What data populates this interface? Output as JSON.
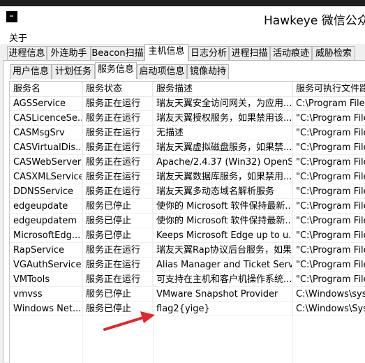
{
  "window": {
    "title": "Hawkeye 微信公众号"
  },
  "menubar": {
    "items": [
      "关于"
    ]
  },
  "main_tabs": [
    "进程信息",
    "外连助手",
    "Beacon扫描",
    "主机信息",
    "日志分析",
    "进程扫描",
    "活动痕迹",
    "威胁检索"
  ],
  "main_tab_active": "主机信息",
  "sub_tabs": [
    "用户信息",
    "计划任务",
    "服务信息",
    "启动项信息",
    "镜像劫持"
  ],
  "sub_tab_active": "服务信息",
  "table": {
    "columns": [
      "服务名",
      "服务状态",
      "服务描述",
      "服务可执行文件路径"
    ],
    "rows": [
      [
        "AGSService",
        "服务正在运行",
        "瑞友天翼安全访问网关，为应用...",
        "C:\\Program Files"
      ],
      [
        "CASLicenceSe...",
        "服务正在运行",
        "瑞友天翼授权服务，如果禁用该...",
        "\"C:\\Program Files"
      ],
      [
        "CASMsgSrv",
        "服务正在运行",
        "无描述",
        "\"C:\\Program Files"
      ],
      [
        "CASVirtualDis...",
        "服务正在运行",
        "瑞友天翼虚拟磁盘服务，如果禁...",
        "\"C:\\Program Files"
      ],
      [
        "CASWebServer",
        "服务正在运行",
        "Apache/2.4.37 (Win32) OpenS...",
        "\"C:\\Program Files"
      ],
      [
        "CASXMLService",
        "服务正在运行",
        "瑞友天翼数据库服务，如果禁用...",
        "\"C:\\Program Files"
      ],
      [
        "DDNSService",
        "服务正在运行",
        "瑞友天翼多动态域名解析服务",
        "\"C:\\Program Files"
      ],
      [
        "edgeupdate",
        "服务已停止",
        "使你的 Microsoft 软件保持最新...",
        "\"C:\\Program Files"
      ],
      [
        "edgeupdatem",
        "服务已停止",
        "使你的 Microsoft 软件保持最新...",
        "\"C:\\Program Files"
      ],
      [
        "MicrosoftEdg...",
        "服务已停止",
        "Keeps Microsoft Edge up to u...",
        "\"C:\\Program Files"
      ],
      [
        "RapService",
        "服务正在运行",
        "瑞友天翼Rap协议后台服务，如果...",
        "\"C:\\Program Files"
      ],
      [
        "VGAuthService",
        "服务正在运行",
        "Alias Manager and Ticket Serv...",
        "\"C:\\Program Files"
      ],
      [
        "VMTools",
        "服务正在运行",
        "可支持在主机和客户机操作系统...",
        "\"C:\\Program Files"
      ],
      [
        "vmvss",
        "服务已停止",
        "VMware Snapshot Provider",
        "C:\\Windows\\syste"
      ],
      [
        "Windows Net...",
        "服务已停止",
        "flag2{yige}",
        "C:\\Windows\\Syste"
      ]
    ]
  },
  "annotation": {
    "color": "#e3262a"
  }
}
